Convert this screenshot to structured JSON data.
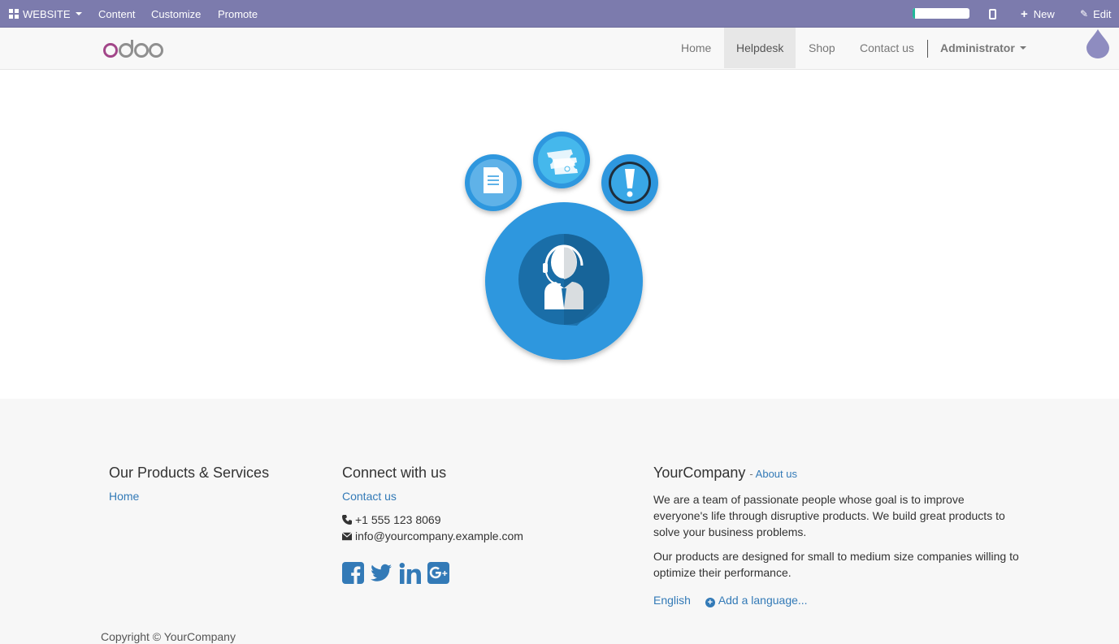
{
  "adminbar": {
    "website_label": "WEBSITE",
    "content_label": "Content",
    "customize_label": "Customize",
    "promote_label": "Promote",
    "progress": 0.04,
    "new_label": "New",
    "edit_label": "Edit",
    "background_color": "#7c7bad"
  },
  "navbar": {
    "logo_text": "odoo",
    "items": [
      {
        "label": "Home"
      },
      {
        "label": "Helpdesk",
        "active": true
      },
      {
        "label": "Shop"
      },
      {
        "label": "Contact us"
      }
    ],
    "user_label": "Administrator"
  },
  "hero": {
    "icons": [
      "document-icon",
      "ticket-icon",
      "alert-icon",
      "support-agent-icon"
    ]
  },
  "footer": {
    "products": {
      "title": "Our Products & Services",
      "links": [
        "Home"
      ]
    },
    "connect": {
      "title": "Connect with us",
      "contact_link": "Contact us",
      "phone": "+1 555 123 8069",
      "email": "info@yourcompany.example.com",
      "social": [
        "facebook-icon",
        "twitter-icon",
        "linkedin-icon",
        "google-plus-icon"
      ]
    },
    "company": {
      "name": "YourCompany",
      "separator": "-",
      "about_link": "About us",
      "paragraph1": "We are a team of passionate people whose goal is to improve everyone's life through disruptive products. We build great products to solve your business problems.",
      "paragraph2": "Our products are designed for small to medium size companies willing to optimize their performance.",
      "language": "English",
      "add_language": "Add a language..."
    },
    "copyright": "Copyright © YourCompany"
  },
  "colors": {
    "link": "#337ab7",
    "hero_blue": "#2d97de",
    "brand_purple": "#a24689"
  }
}
